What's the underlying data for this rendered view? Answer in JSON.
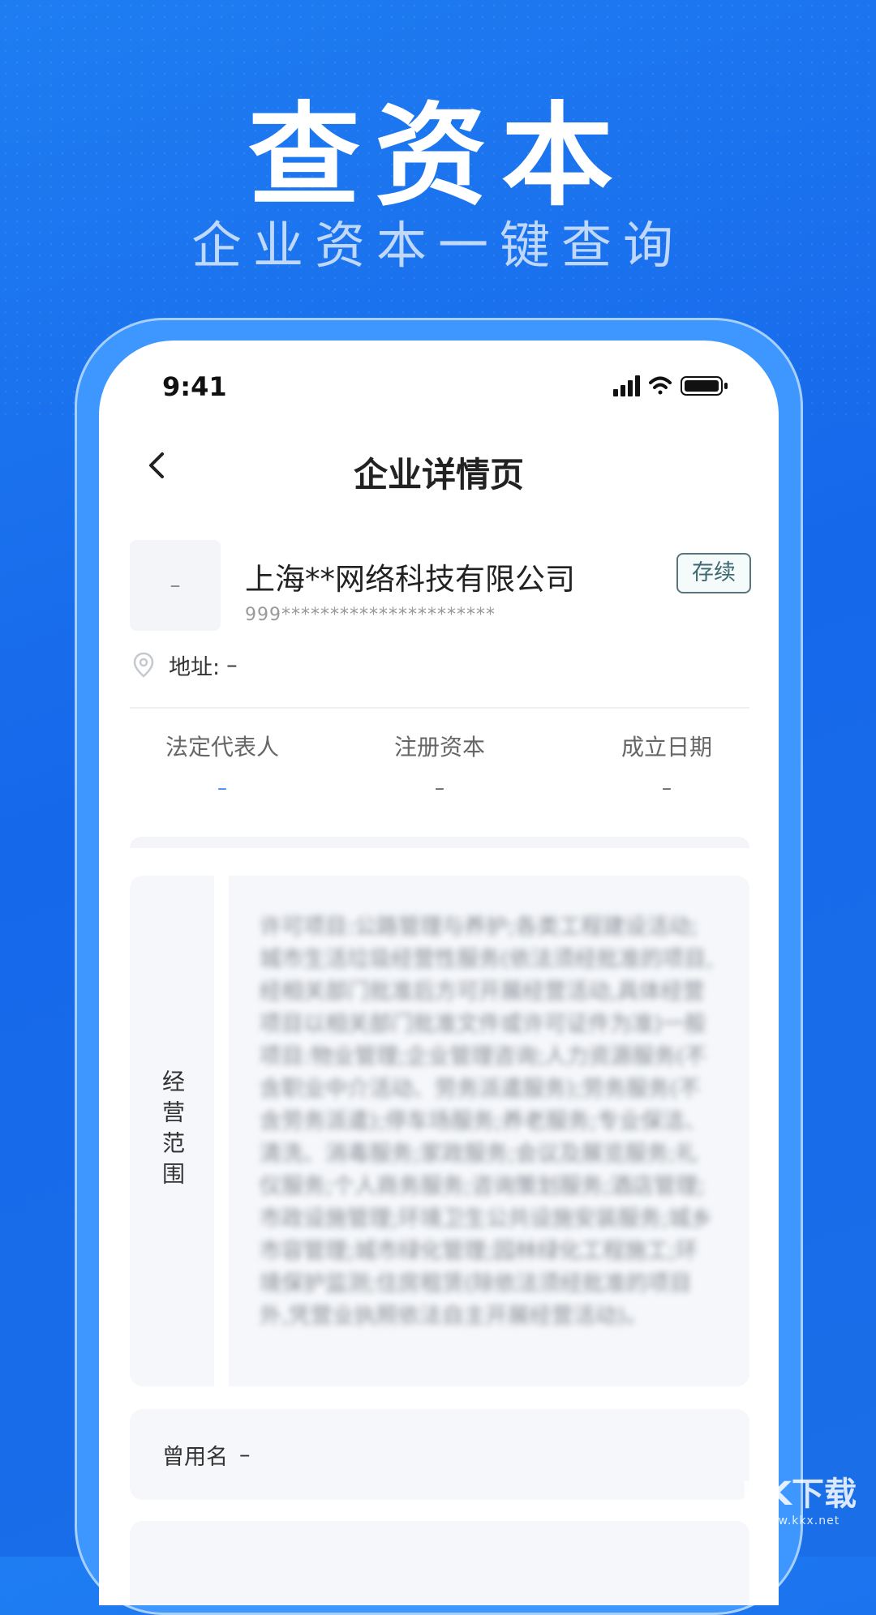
{
  "hero": {
    "title": "查资本",
    "subtitle": "企业资本一键查询"
  },
  "status_bar": {
    "time": "9:41",
    "icons": [
      "signal-icon",
      "wifi-icon",
      "battery-icon"
    ]
  },
  "nav": {
    "back_icon": "chevron-left-icon",
    "title": "企业详情页"
  },
  "company": {
    "logo_placeholder": "–",
    "name": "上海**网络科技有限公司",
    "code": "999**********************",
    "status": "存续",
    "address_icon": "location-pin-icon",
    "address_label": "地址:",
    "address_value": "–"
  },
  "stats": [
    {
      "label": "法定代表人",
      "value": "–",
      "color": "#2f7cf6"
    },
    {
      "label": "注册资本",
      "value": "–",
      "color": "#555555"
    },
    {
      "label": "成立日期",
      "value": "–",
      "color": "#555555"
    }
  ],
  "scope": {
    "label": "经营范围",
    "text": "许可项目:公路管理与养护;各类工程建设活动;城市生活垃圾经营性服务(依法须经批准的项目,经相关部门批准后方可开展经营活动,具体经营项目以相关部门批准文件或许可证件为准)一般项目:物业管理;企业管理咨询;人力资源服务(不含职业中介活动、劳务派遣服务);劳务服务(不含劳务派遣);停车场服务;养老服务;专业保洁、清洗、消毒服务;家政服务;会议及展览服务;礼仪服务;个人商务服务;咨询策划服务;酒店管理;市政设施管理;环境卫生公共设施安装服务;城乡市容管理;城市绿化管理;园林绿化工程施工;环境保护监测;住房租赁(除依法须经批准的项目外,凭营业执照依法自主开展经营活动)。"
  },
  "former_name": {
    "label": "曾用名",
    "value": "–"
  },
  "watermark": {
    "main": "KK下载",
    "sub": "www.kkx.net"
  },
  "colors": {
    "background": "#1668ea",
    "frame": "#3d97ff",
    "accent": "#2f7cf6",
    "badge_border": "#57767b"
  }
}
